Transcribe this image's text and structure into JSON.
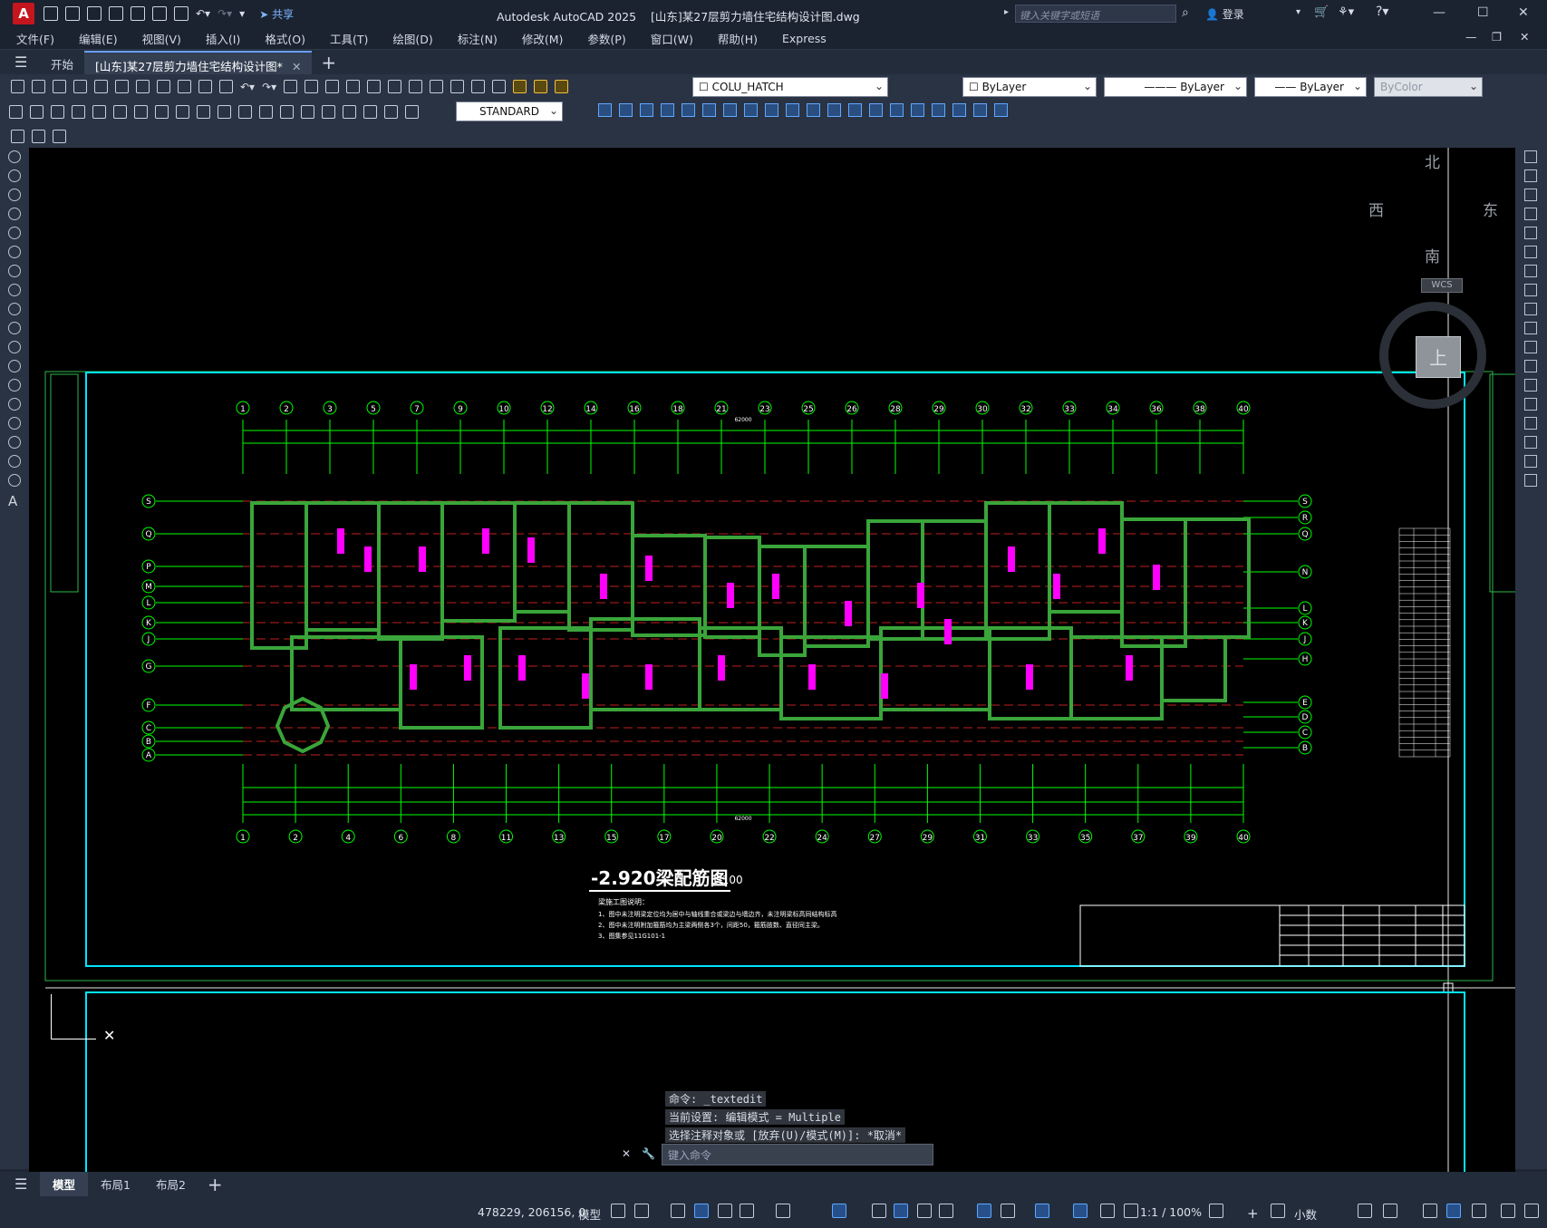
{
  "app": {
    "logo_letter": "A",
    "title": "Autodesk AutoCAD 2025",
    "doc_title": "[山东]某27层剪力墙住宅结构设计图.dwg",
    "share": "共享",
    "search_placeholder": "键入关键字或短语",
    "login": "登录"
  },
  "menus": [
    "文件(F)",
    "编辑(E)",
    "视图(V)",
    "插入(I)",
    "格式(O)",
    "工具(T)",
    "绘图(D)",
    "标注(N)",
    "修改(M)",
    "参数(P)",
    "窗口(W)",
    "帮助(H)",
    "Express"
  ],
  "tabs": {
    "start": "开始",
    "doc": "[山东]某27层剪力墙住宅结构设计图*"
  },
  "properties": {
    "layer": "COLU_HATCH",
    "textstyle": "STANDARD",
    "color": "ByLayer",
    "linetype": "ByLayer",
    "lineweight": "ByLayer",
    "plotstyle": "ByColor"
  },
  "viewcube": {
    "north": "北",
    "south": "南",
    "east": "东",
    "west": "西",
    "top": "上",
    "wcs": "WCS"
  },
  "drawing": {
    "title": "-2.920梁配筋图",
    "scale": "1:100",
    "notes_heading": "梁施工图说明：",
    "note1": "1、图中未注明梁定位均为居中与轴线重合或梁边与墙边齐，未注明梁标高同结构标高",
    "note2": "2、图中未注明附加箍筋均为主梁两侧各3个，间距50，箍筋肢数、直径同主梁。",
    "note3": "3、图集参见11G101-1",
    "top_axes": [
      "1",
      "2",
      "3",
      "5",
      "7",
      "9",
      "10",
      "12",
      "14",
      "16",
      "18",
      "21",
      "23",
      "25",
      "26",
      "28",
      "29",
      "30",
      "32",
      "33",
      "34",
      "36",
      "38",
      "40"
    ],
    "bottom_axes": [
      "1",
      "2",
      "4",
      "6",
      "8",
      "11",
      "13",
      "15",
      "17",
      "20",
      "22",
      "24",
      "27",
      "29",
      "31",
      "33",
      "35",
      "37",
      "39",
      "40"
    ],
    "left_axes": [
      "S",
      "Q",
      "P",
      "M",
      "L",
      "K",
      "J",
      "G",
      "F",
      "C",
      "B",
      "A"
    ],
    "right_axes": [
      "S",
      "R",
      "Q",
      "N",
      "L",
      "K",
      "J",
      "H",
      "E",
      "D",
      "C",
      "B"
    ],
    "top_total": "62000",
    "bottom_total": "62000"
  },
  "commands": {
    "line1": "命令: _textedit",
    "line2": "当前设置: 编辑模式 = Multiple",
    "line3": "选择注释对象或 [放弃(U)/模式(M)]: *取消*",
    "input_placeholder": "键入命令"
  },
  "layout_tabs": {
    "model": "模型",
    "layout1": "布局1",
    "layout2": "布局2"
  },
  "status": {
    "coordinates": "478229, 206156, 0",
    "model": "模型",
    "scale": "1:1 / 100%",
    "units": "小数"
  },
  "colors": {
    "canvas": "#000000",
    "cyan_border": "#00e5ff",
    "axis_green": "#00ff00",
    "wall_green": "#3aa53a",
    "red_dash": "#ff2a2a",
    "magenta_text": "#ff00ff"
  }
}
